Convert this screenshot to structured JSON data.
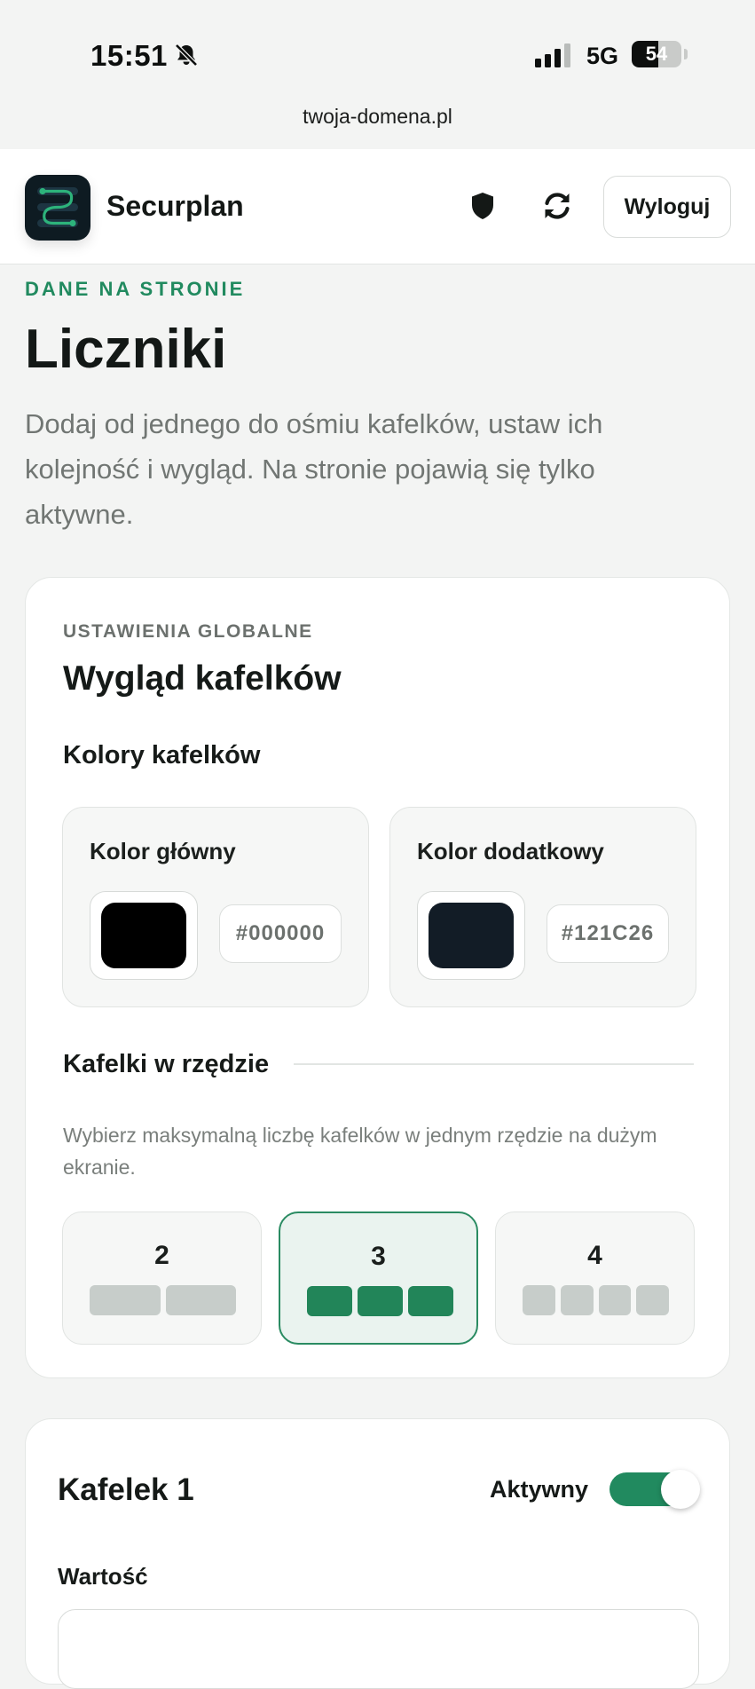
{
  "status_bar": {
    "time": "15:51",
    "network": "5G",
    "battery": "54",
    "battery_level": 0.54
  },
  "browser": {
    "url": "twoja-domena.pl"
  },
  "header": {
    "brand": "Securplan",
    "logout_label": "Wyloguj",
    "icons": [
      "shield-icon",
      "refresh-icon"
    ]
  },
  "intro": {
    "eyebrow": "DANE NA STRONIE",
    "title": "Liczniki",
    "description": "Dodaj od jednego do ośmiu kafelków, ustaw ich kolejność i wygląd. Na stronie pojawią się tylko aktywne."
  },
  "global_settings": {
    "kicker": "USTAWIENIA GLOBALNE",
    "title": "Wygląd kafelków",
    "colors_heading": "Kolory kafelków",
    "primary": {
      "label": "Kolor główny",
      "value": "#000000",
      "color": "#000000"
    },
    "secondary": {
      "label": "Kolor dodatkowy",
      "value": "#121C26",
      "color": "#121C26"
    },
    "per_row_heading": "Kafelki w rzędzie",
    "per_row_hint": "Wybierz maksymalną liczbę kafelków w jednym rzędzie na dużym ekranie.",
    "options": [
      {
        "label": "2",
        "count": 2,
        "selected": false
      },
      {
        "label": "3",
        "count": 3,
        "selected": true
      },
      {
        "label": "4",
        "count": 4,
        "selected": false
      }
    ]
  },
  "tile1": {
    "title": "Kafelek 1",
    "active_label": "Aktywny",
    "active": true,
    "value_label": "Wartość"
  },
  "colors": {
    "accent": "#218a5f",
    "accent_light": "#eaf3ef",
    "bar_inactive": "#c7cdca"
  }
}
